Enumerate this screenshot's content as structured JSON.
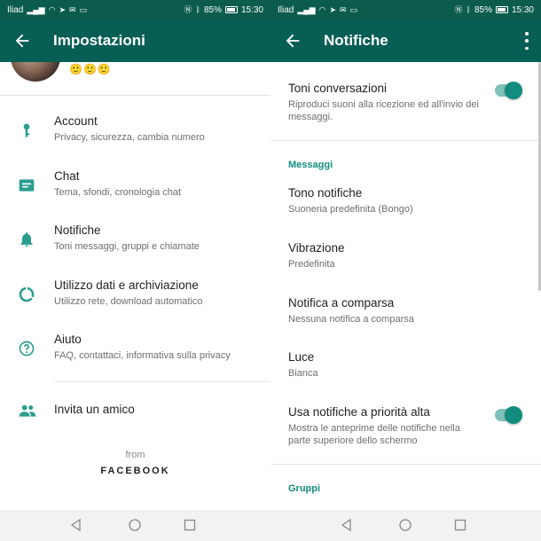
{
  "status_bar": {
    "carrier": "Iliad",
    "battery": "85%",
    "time": "15:30"
  },
  "left": {
    "title": "Impostazioni",
    "profile_emoji": "🙂🙂🙂",
    "items": [
      {
        "label": "Account",
        "sub": "Privacy, sicurezza, cambia numero",
        "icon": "key-icon"
      },
      {
        "label": "Chat",
        "sub": "Tema, sfondi, cronologia chat",
        "icon": "chat-icon"
      },
      {
        "label": "Notifiche",
        "sub": "Toni messaggi, gruppi e chiamate",
        "icon": "bell-icon"
      },
      {
        "label": "Utilizzo dati e archiviazione",
        "sub": "Utilizzo rete, download automatico",
        "icon": "data-usage-icon"
      },
      {
        "label": "Aiuto",
        "sub": "FAQ, contattaci, informativa sulla privacy",
        "icon": "help-icon"
      }
    ],
    "invite": "Invita un amico",
    "from": "from",
    "brand": "FACEBOOK"
  },
  "right": {
    "title": "Notifiche",
    "toni": {
      "label": "Toni conversazioni",
      "sub": "Riproduci suoni alla ricezione ed all'invio dei messaggi.",
      "enabled": true
    },
    "section_messaggi": "Messaggi",
    "tono": {
      "label": "Tono notifiche",
      "sub": "Suoneria predefinita (Bongo)"
    },
    "vibrazione": {
      "label": "Vibrazione",
      "sub": "Predefinita"
    },
    "comparsa": {
      "label": "Notifica a comparsa",
      "sub": "Nessuna notifica a comparsa"
    },
    "luce": {
      "label": "Luce",
      "sub": "Bianca"
    },
    "priorita": {
      "label": "Usa notifiche a priorità alta",
      "sub": "Mostra le anteprime delle notifiche nella parte superiore dello schermo",
      "enabled": true
    },
    "section_gruppi": "Gruppi"
  },
  "colors": {
    "header": "#075e54",
    "status": "#0b5c4c",
    "accent": "#128c7e",
    "icon": "#2a9d8f"
  }
}
